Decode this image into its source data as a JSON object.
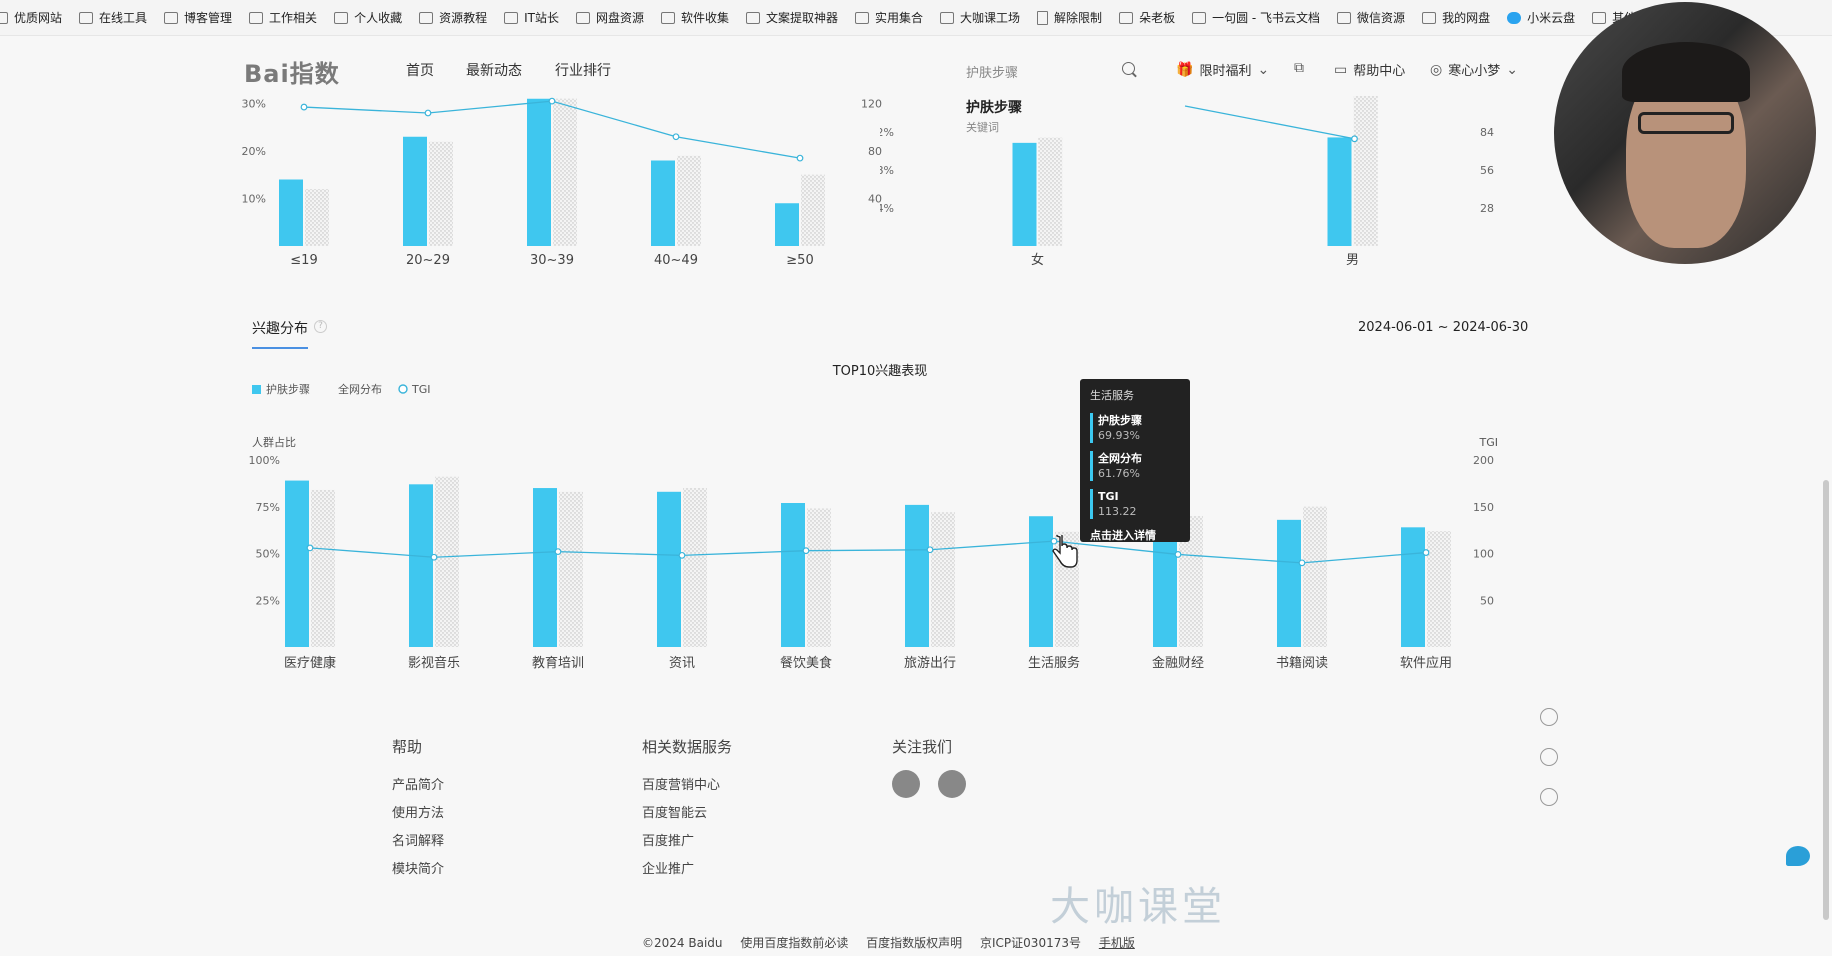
{
  "bookmarks": [
    "优质网站",
    "在线工具",
    "博客管理",
    "工作相关",
    "个人收藏",
    "资源教程",
    "IT站长",
    "网盘资源",
    "软件收集",
    "文案提取神器",
    "实用集合",
    "大咖课工场",
    "解除限制",
    "朵老板",
    "一句圆 - 飞书云文档",
    "微信资源",
    "我的网盘",
    "小米云盘",
    "其他收藏夹"
  ],
  "header": {
    "logo": "Bai指数",
    "nav": [
      "首页",
      "最新动态",
      "行业排行"
    ],
    "search_value": "护肤步骤",
    "promo": "限时福利",
    "help": "帮助中心",
    "user": "寒心小梦"
  },
  "section": {
    "tab": "兴趣分布",
    "date_range": "2024-06-01 ~ 2024-06-30"
  },
  "tooltip": {
    "category": "生活服务",
    "rows": [
      {
        "name": "护肤步骤",
        "value": "69.93%"
      },
      {
        "name": "全网分布",
        "value": "61.76%"
      },
      {
        "name": "TGI",
        "value": "113.22"
      }
    ],
    "link": "点击进入详情"
  },
  "chart_data": [
    {
      "type": "bar",
      "categories": [
        "≤19",
        "20~29",
        "30~39",
        "40~49",
        "≥50"
      ],
      "series": [
        {
          "name": "护肤步骤",
          "values": [
            14,
            23,
            31,
            18,
            9
          ]
        },
        {
          "name": "全网分布",
          "values": [
            12,
            22,
            31,
            19,
            15
          ]
        },
        {
          "name": "TGI",
          "values": [
            117,
            112,
            122,
            92,
            74
          ]
        }
      ],
      "y_ticks": [
        "10%",
        "20%",
        "30%"
      ],
      "y2_ticks": [
        "40",
        "80",
        "120"
      ],
      "ylim": [
        0,
        32
      ],
      "y2lim": [
        0,
        128
      ]
    },
    {
      "type": "bar",
      "title": "护肤步骤",
      "subtitle": "关键词",
      "categories": [
        "女",
        "男"
      ],
      "series": [
        {
          "name": "护肤步骤",
          "values": [
            38,
            40
          ]
        },
        {
          "name": "全网分布",
          "values": [
            40,
            56
          ]
        },
        {
          "name": "TGI",
          "values": [
            120,
            79
          ]
        }
      ],
      "y_ticks": [
        "14%",
        "28%",
        "42%"
      ],
      "y2_ticks": [
        "28",
        "56",
        "84"
      ],
      "ylim": [
        0,
        56
      ],
      "y2lim": [
        0,
        112
      ]
    },
    {
      "type": "bar",
      "title": "TOP10兴趣表现",
      "ylabel": "人群占比",
      "y2label": "TGI",
      "legend": [
        "护肤步骤",
        "全网分布",
        "TGI"
      ],
      "categories": [
        "医疗健康",
        "影视音乐",
        "教育培训",
        "资讯",
        "餐饮美食",
        "旅游出行",
        "生活服务",
        "金融财经",
        "书籍阅读",
        "软件应用"
      ],
      "series": [
        {
          "name": "护肤步骤",
          "values": [
            89,
            87,
            85,
            83,
            77,
            76,
            69.93,
            67,
            68,
            64
          ]
        },
        {
          "name": "全网分布",
          "values": [
            84,
            91,
            83,
            85,
            74,
            72,
            61.76,
            70,
            75,
            62
          ]
        },
        {
          "name": "TGI",
          "values": [
            106,
            96,
            102,
            98,
            103,
            104,
            113.22,
            99,
            90,
            101
          ]
        }
      ],
      "y_ticks": [
        "25%",
        "50%",
        "75%",
        "100%"
      ],
      "y2_ticks": [
        "50",
        "100",
        "150",
        "200"
      ],
      "ylim": [
        0,
        100
      ],
      "y2lim": [
        0,
        200
      ]
    }
  ],
  "footer": {
    "help_title": "帮助",
    "help_links": [
      "产品简介",
      "使用方法",
      "名词解释",
      "模块简介"
    ],
    "services_title": "相关数据服务",
    "services_links": [
      "百度营销中心",
      "百度智能云",
      "百度推广",
      "企业推广"
    ],
    "follow_title": "关注我们",
    "watermark": "大咖课堂",
    "copyright": [
      "©2024 Baidu",
      "使用百度指数前必读",
      "百度指数版权声明",
      "京ICP证030173号",
      "手机版"
    ]
  },
  "colors": {
    "primary_bar": "#3fc7ef",
    "line": "#3ab4da",
    "hatched": "#d0d0d0"
  }
}
